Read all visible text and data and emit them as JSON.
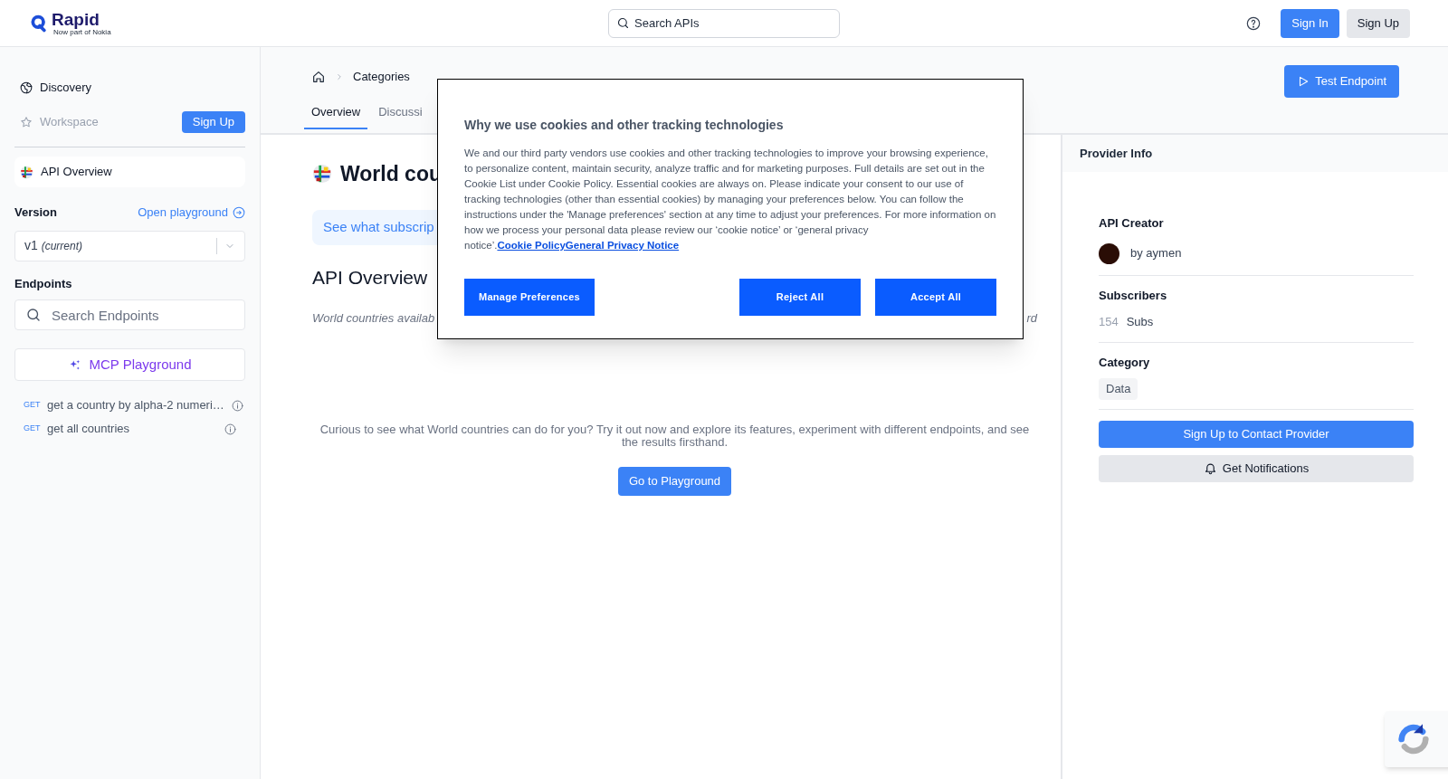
{
  "header": {
    "logo": {
      "name": "Rapid",
      "tagline": "Now part of Nokia"
    },
    "search": {
      "placeholder": "Search APIs"
    },
    "buttons": [
      {
        "label": "Sign In",
        "kind": "primary"
      },
      {
        "label": "Sign Up",
        "kind": "secondary"
      }
    ]
  },
  "sidebar": {
    "nav": [
      {
        "label": "Discovery",
        "disabled": false
      },
      {
        "label": "Workspace",
        "disabled": true
      }
    ],
    "workspace_button": "Sign Up",
    "api_overview": {
      "label": "API Overview"
    },
    "version": {
      "label": "Version",
      "link": "Open playground",
      "value": "v1",
      "note": "(current)"
    },
    "endpoints": {
      "label": "Endpoints",
      "search_placeholder": "Search Endpoints",
      "mcp_button": "MCP Playground",
      "items": [
        {
          "method": "GET",
          "name": "get a country by alpha-2 numeri…"
        },
        {
          "method": "GET",
          "name": "get all countries"
        }
      ]
    }
  },
  "main": {
    "breadcrumb": [
      "Categories"
    ],
    "tabs": [
      {
        "label": "Overview",
        "selected": true
      },
      {
        "label": "Discussi",
        "selected": false
      }
    ],
    "test_button": "Test Endpoint",
    "title": "World cou",
    "subscribe_banner": "See what subscrip",
    "section_heading": "API Overview",
    "description_start": "World countries availab",
    "description_end": "rd",
    "cta_text": "Curious to see what World countries can do for you? Try it out now and explore its features, experiment with different endpoints, and see the results firsthand.",
    "cta_button": "Go to Playground"
  },
  "provider_info": {
    "title": "Provider Info",
    "creator_label": "API Creator",
    "creator": "by aymen",
    "subscribers_label": "Subscribers",
    "subscribers_count": "154",
    "subscribers_unit": "Subs",
    "category_label": "Category",
    "category": "Data",
    "contact_button": "Sign Up to Contact Provider",
    "notify_button": "Get Notifications"
  },
  "cookie_dialog": {
    "title": "Why we use cookies and other tracking technologies",
    "body": "We and our third party vendors use cookies and other tracking technologies to improve your browsing experience, to personalize content, maintain security, analyze traffic and for marketing purposes. Full details are set out in the Cookie List under Cookie Policy. Essential cookies are always on. Please indicate your consent to our use of tracking technologies (other than essential cookies) by managing your preferences below. You can follow the instructions under the 'Manage preferences' section at any time to adjust your preferences. For more information on how we process your personal data please review our ‘cookie notice’ or ‘general privacy notice’.",
    "links": [
      "Cookie Policy",
      "General Privacy Notice"
    ],
    "buttons": [
      {
        "label": "Manage Preferences"
      },
      {
        "label": "Reject All"
      },
      {
        "label": "Accept All"
      }
    ]
  }
}
